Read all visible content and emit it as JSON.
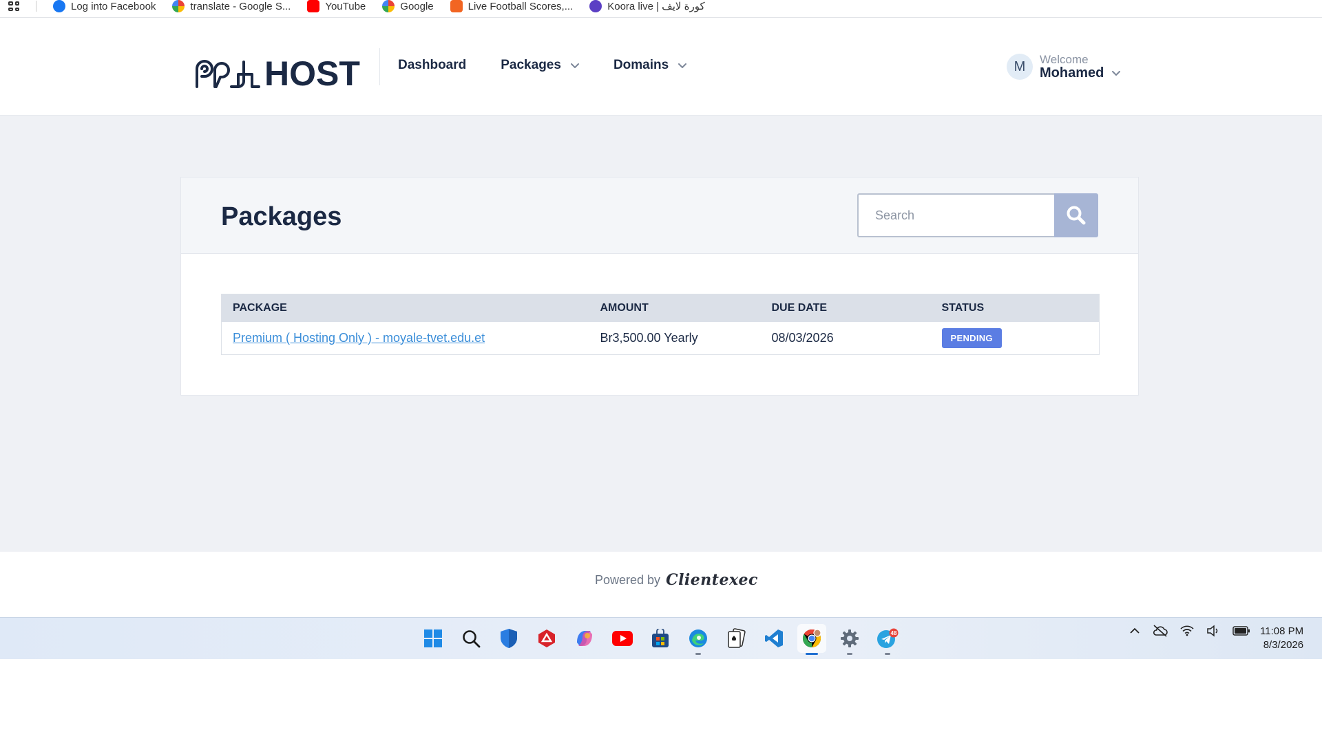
{
  "bookmarks": [
    {
      "label": "Log into Facebook",
      "color": "#1877f2"
    },
    {
      "label": "translate - Google S...",
      "color": "#4285f4"
    },
    {
      "label": "YouTube",
      "color": "#ff0000"
    },
    {
      "label": "Google",
      "color": "#4285f4"
    },
    {
      "label": "Live Football Scores,...",
      "color": "#f26522"
    },
    {
      "label": "Koora live | كورة لايف",
      "color": "#5b3fc4"
    }
  ],
  "header": {
    "logo_text": "HOST",
    "nav": {
      "dashboard": "Dashboard",
      "packages": "Packages",
      "domains": "Domains"
    },
    "user": {
      "avatar_initial": "M",
      "welcome": "Welcome",
      "name": "Mohamed"
    }
  },
  "page": {
    "title": "Packages",
    "search_placeholder": "Search",
    "table": {
      "columns": [
        "PACKAGE",
        "AMOUNT",
        "DUE DATE",
        "STATUS"
      ],
      "rows": [
        {
          "package": "Premium ( Hosting Only ) - moyale-tvet.edu.et",
          "amount": "Br3,500.00 Yearly",
          "due_date": "08/03/2026",
          "status": "PENDING"
        }
      ]
    }
  },
  "footer": {
    "powered_by": "Powered by",
    "brand": "Clientexec"
  },
  "taskbar": {
    "apps": [
      "windows-start",
      "search",
      "defender",
      "adobe-acrobat",
      "copilot",
      "youtube",
      "microsoft-store",
      "edge",
      "solitaire",
      "vs-code",
      "chrome",
      "settings",
      "telegram"
    ],
    "telegram_badge": "48",
    "clock_time": "11:08 PM",
    "clock_date": "8/3/2026"
  },
  "colors": {
    "brand_navy": "#1b2944",
    "link": "#3b8ed9",
    "pending_badge": "#5b7de3",
    "search_button": "#a7b5d5",
    "page_bg": "#eff1f5"
  }
}
